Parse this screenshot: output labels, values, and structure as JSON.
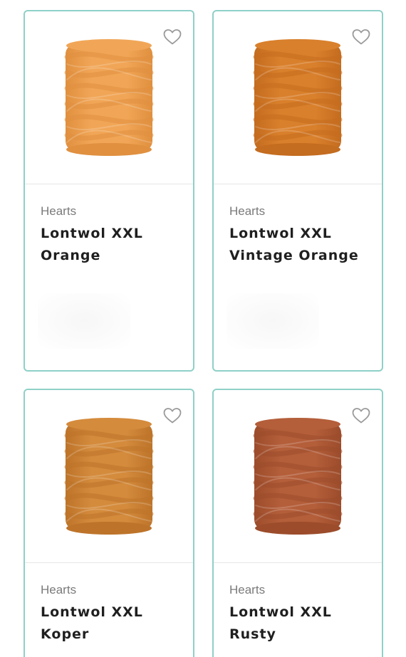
{
  "products": [
    {
      "brand": "Hearts",
      "title_line1": "Lontwol XXL",
      "title_line2": "Orange",
      "color": "#f1a657",
      "shade": "#e0903f",
      "icon": "heart-outline-icon"
    },
    {
      "brand": "Hearts",
      "title_line1": "Lontwol XXL",
      "title_line2": "Vintage Orange",
      "color": "#d9802c",
      "shade": "#c46c1f",
      "icon": "heart-outline-icon"
    },
    {
      "brand": "Hearts",
      "title_line1": "Lontwol XXL",
      "title_line2": "Koper",
      "color": "#d48b3c",
      "shade": "#bd742a",
      "icon": "heart-outline-icon"
    },
    {
      "brand": "Hearts",
      "title_line1": "Lontwol XXL",
      "title_line2": "Rusty",
      "color": "#b45e3a",
      "shade": "#9c4c2b",
      "icon": "heart-outline-icon"
    }
  ]
}
